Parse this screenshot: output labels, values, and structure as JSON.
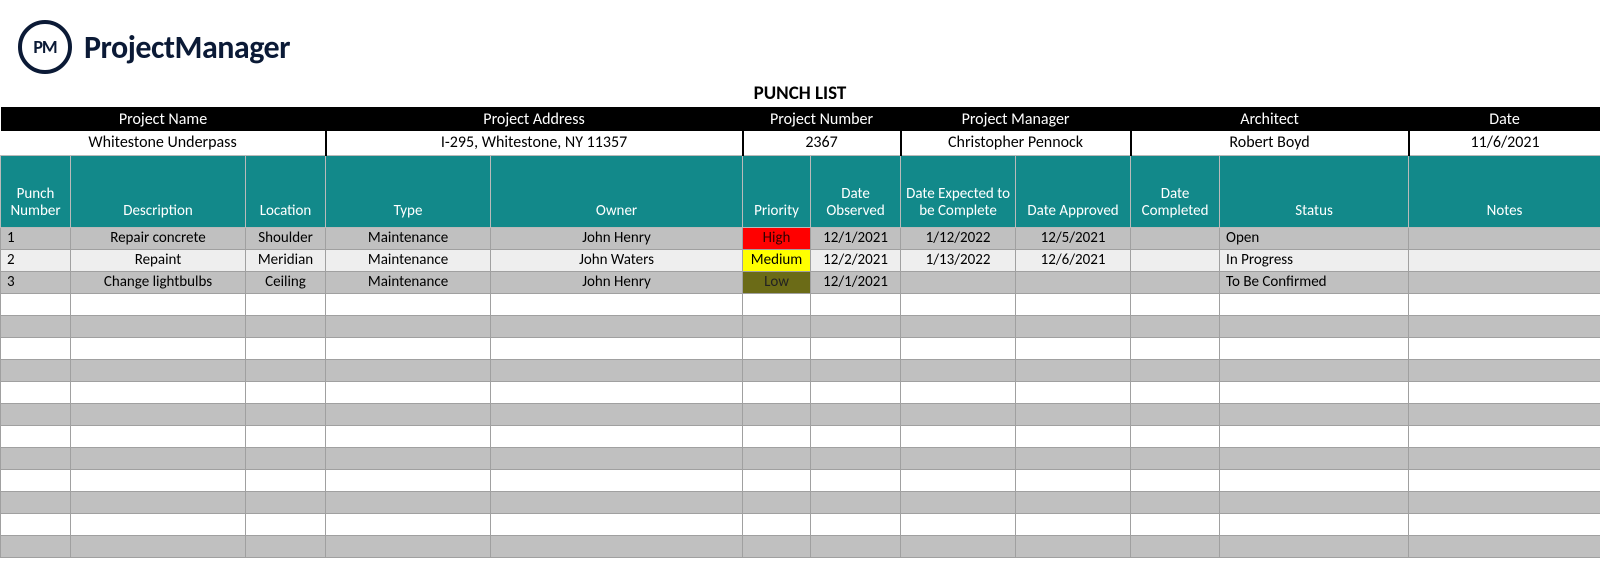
{
  "brand": {
    "abbr": "PM",
    "name": "ProjectManager"
  },
  "title": "PUNCH LIST",
  "info": {
    "headers": [
      "Project Name",
      "Project Address",
      "Project Number",
      "Project Manager",
      "Architect",
      "Date"
    ],
    "values": {
      "project_name": "Whitestone Underpass",
      "project_address": "I-295, Whitestone, NY 11357",
      "project_number": "2367",
      "project_manager": "Christopher Pennock",
      "architect": "Robert Boyd",
      "date": "11/6/2021"
    }
  },
  "columns": [
    "Punch Number",
    "Description",
    "Location",
    "Type",
    "Owner",
    "Priority",
    "Date Observed",
    "Date Expected to be Complete",
    "Date Approved",
    "Date Completed",
    "Status",
    "Notes"
  ],
  "rows": [
    {
      "num": "1",
      "desc": "Repair concrete",
      "loc": "Shoulder",
      "type": "Maintenance",
      "owner": "John Henry",
      "priority": "High",
      "observed": "12/1/2021",
      "expected": "1/12/2022",
      "approved": "12/5/2021",
      "completed": "",
      "status": "Open",
      "notes": ""
    },
    {
      "num": "2",
      "desc": "Repaint",
      "loc": "Meridian",
      "type": "Maintenance",
      "owner": "John Waters",
      "priority": "Medium",
      "observed": "12/2/2021",
      "expected": "1/13/2022",
      "approved": "12/6/2021",
      "completed": "",
      "status": "In Progress",
      "notes": ""
    },
    {
      "num": "3",
      "desc": "Change lightbulbs",
      "loc": "Ceiling",
      "type": "Maintenance",
      "owner": "John Henry",
      "priority": "Low",
      "observed": "12/1/2021",
      "expected": "",
      "approved": "",
      "completed": "",
      "status": "To Be Confirmed",
      "notes": ""
    }
  ],
  "empty_rows": 12,
  "priority_colors": {
    "High": "pri-high",
    "Medium": "pri-med",
    "Low": "pri-low"
  }
}
